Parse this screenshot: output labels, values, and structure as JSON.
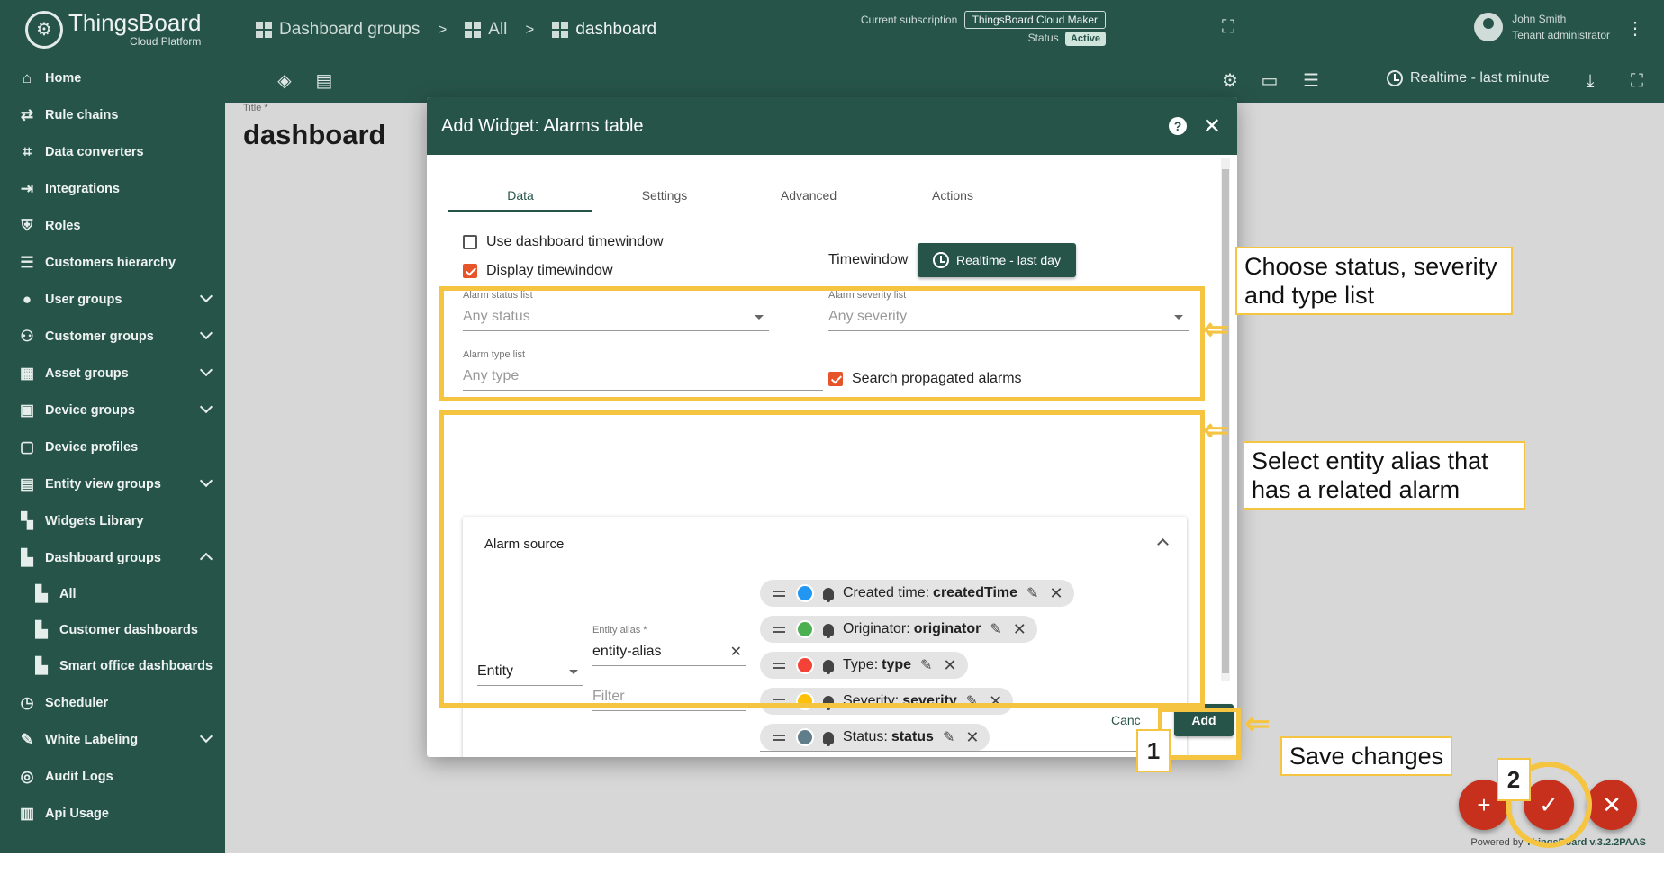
{
  "brand": {
    "name": "ThingsBoard",
    "sub": "Cloud Platform"
  },
  "breadcrumbs": [
    {
      "label": "Dashboard groups"
    },
    {
      "label": "All"
    },
    {
      "label": "dashboard"
    }
  ],
  "subscription": {
    "label": "Current subscription",
    "plan": "ThingsBoard Cloud Maker",
    "status_label": "Status",
    "status": "Active"
  },
  "user": {
    "name": "John Smith",
    "role": "Tenant administrator"
  },
  "sidebar": {
    "items": [
      {
        "label": "Home",
        "icon": "⌂"
      },
      {
        "label": "Rule chains",
        "icon": "⇄"
      },
      {
        "label": "Data converters",
        "icon": "⌗"
      },
      {
        "label": "Integrations",
        "icon": "⇥"
      },
      {
        "label": "Roles",
        "icon": "⛨"
      },
      {
        "label": "Customers hierarchy",
        "icon": "☰"
      },
      {
        "label": "User groups",
        "icon": "●"
      },
      {
        "label": "Customer groups",
        "icon": "⚇"
      },
      {
        "label": "Asset groups",
        "icon": "▦"
      },
      {
        "label": "Device groups",
        "icon": "▣"
      },
      {
        "label": "Device profiles",
        "icon": "▢"
      },
      {
        "label": "Entity view groups",
        "icon": "▤"
      },
      {
        "label": "Widgets Library",
        "icon": "▚"
      },
      {
        "label": "Dashboard groups",
        "icon": "▙"
      },
      {
        "label": "All",
        "icon": "▙"
      },
      {
        "label": "Customer dashboards",
        "icon": "▙"
      },
      {
        "label": "Smart office dashboards",
        "icon": "▙"
      },
      {
        "label": "Scheduler",
        "icon": "◷"
      },
      {
        "label": "White Labeling",
        "icon": "✎"
      },
      {
        "label": "Audit Logs",
        "icon": "◎"
      },
      {
        "label": "Api Usage",
        "icon": "▥"
      }
    ]
  },
  "toolbar": {
    "timewindow": "Realtime - last minute"
  },
  "dashboard": {
    "title_label": "Title *",
    "title": "dashboard"
  },
  "dialog": {
    "title": "Add Widget: Alarms table",
    "tabs": [
      "Data",
      "Settings",
      "Advanced",
      "Actions"
    ],
    "use_dashboard_timewindow": "Use dashboard timewindow",
    "display_timewindow": "Display timewindow",
    "timewindow_label": "Timewindow",
    "timewindow_value": "Realtime - last day",
    "status_list_label": "Alarm status list",
    "status_list_placeholder": "Any status",
    "severity_list_label": "Alarm severity list",
    "severity_list_placeholder": "Any severity",
    "type_list_label": "Alarm type list",
    "type_list_placeholder": "Any type",
    "search_propagated": "Search propagated alarms",
    "alarm_source_title": "Alarm source",
    "source_type": "Entity",
    "entity_alias_label": "Entity alias *",
    "entity_alias_value": "entity-alias",
    "filter_placeholder": "Filter",
    "keys": [
      {
        "label": "Created time:",
        "key": "createdTime",
        "color": "#2196f3"
      },
      {
        "label": "Originator:",
        "key": "originator",
        "color": "#4caf50"
      },
      {
        "label": "Type:",
        "key": "type",
        "color": "#f44336"
      },
      {
        "label": "Severity:",
        "key": "severity",
        "color": "#ffc107"
      },
      {
        "label": "Status:",
        "key": "status",
        "color": "#607d8b"
      }
    ],
    "cancel_label": "Canc",
    "add_label": "Add"
  },
  "annotations": {
    "callout1": "Choose status, severity and type list",
    "callout2": "Select entity alias that has a related alarm",
    "callout3": "Save changes",
    "num1": "1",
    "num2": "2"
  },
  "footer": {
    "powered": "Powered by",
    "version": "ThingsBoard v.3.2.2PAAS"
  },
  "colors": {
    "primary": "#275449",
    "accent": "#f5c542",
    "fab": "#c7301c",
    "checkbox": "#e8542a"
  }
}
